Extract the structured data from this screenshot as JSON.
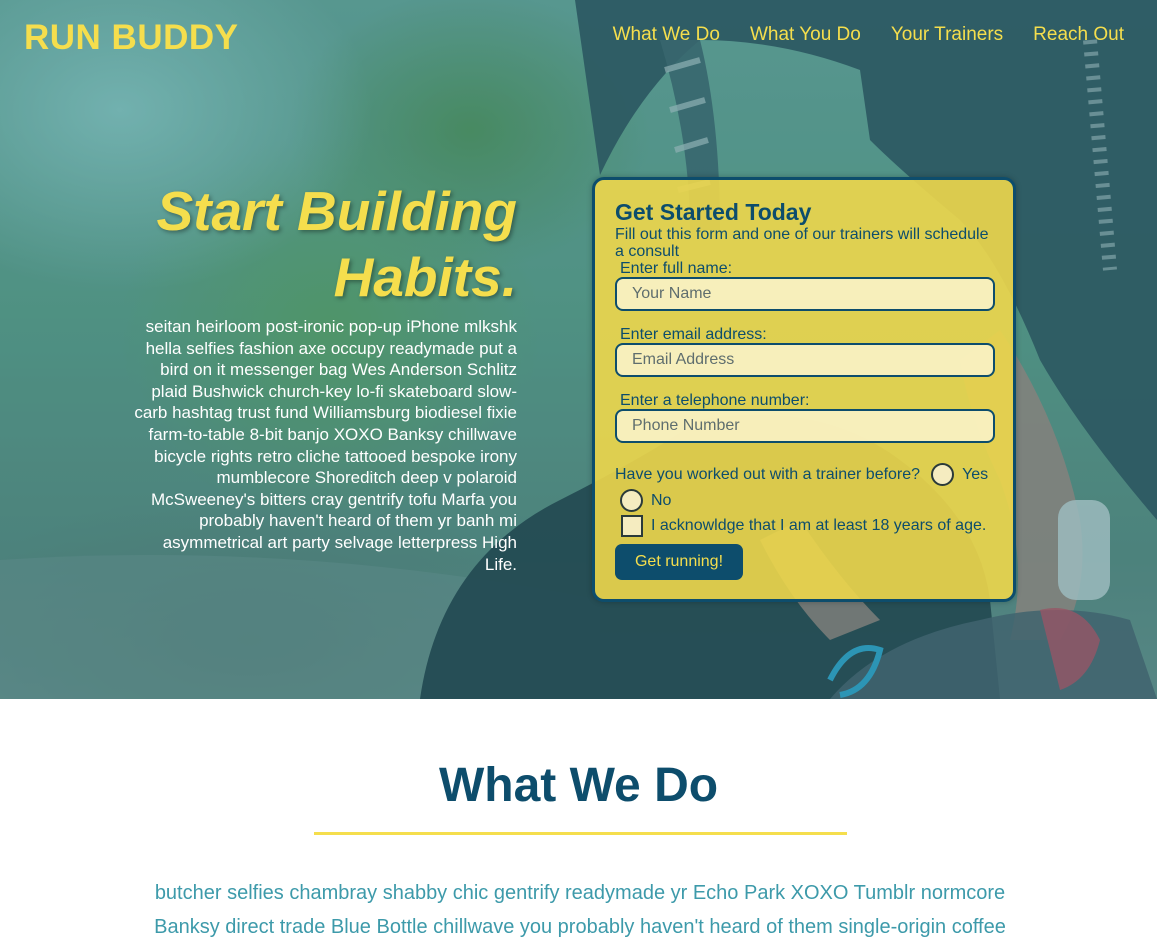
{
  "header": {
    "logo": "RUN BUDDY",
    "nav": [
      "What We Do",
      "What You Do",
      "Your Trainers",
      "Reach Out"
    ]
  },
  "hero": {
    "title_line1": "Start Building",
    "title_line2": "Habits.",
    "body": "seitan heirloom post-ironic pop-up iPhone mlkshk hella selfies fashion axe occupy readymade put a bird on it messenger bag Wes Anderson Schlitz plaid Bushwick church-key lo-fi skateboard slow-carb hashtag trust fund Williamsburg biodiesel fixie farm-to-table 8-bit banjo XOXO Banksy chillwave bicycle rights retro cliche tattooed bespoke irony mumblecore Shoreditch deep v polaroid McSweeney's bitters cray gentrify tofu Marfa you probably haven't heard of them yr banh mi asymmetrical art party selvage letterpress High Life."
  },
  "form": {
    "title": "Get Started Today",
    "subtitle": "Fill out this form and one of our trainers will schedule a consult",
    "name_label": "Enter full name:",
    "name_placeholder": "Your Name",
    "email_label": "Enter email address:",
    "email_placeholder": "Email Address",
    "phone_label": "Enter a telephone number:",
    "phone_placeholder": "Phone Number",
    "question": "Have you worked out with a trainer before?",
    "yes": "Yes",
    "no": "No",
    "acknowledge": "I acknowldge that I am at least 18 years of age.",
    "submit": "Get running!"
  },
  "what_we_do": {
    "title": "What We Do",
    "body": "butcher selfies chambray shabby chic gentrify readymade yr Echo Park XOXO Tumblr normcore Banksy direct trade Blue Bottle chillwave you probably haven't heard of them single-origin coffee"
  },
  "colors": {
    "yellow": "#f5de4d",
    "navy": "#0d4d6c",
    "teal_text": "#3d9aaa"
  }
}
